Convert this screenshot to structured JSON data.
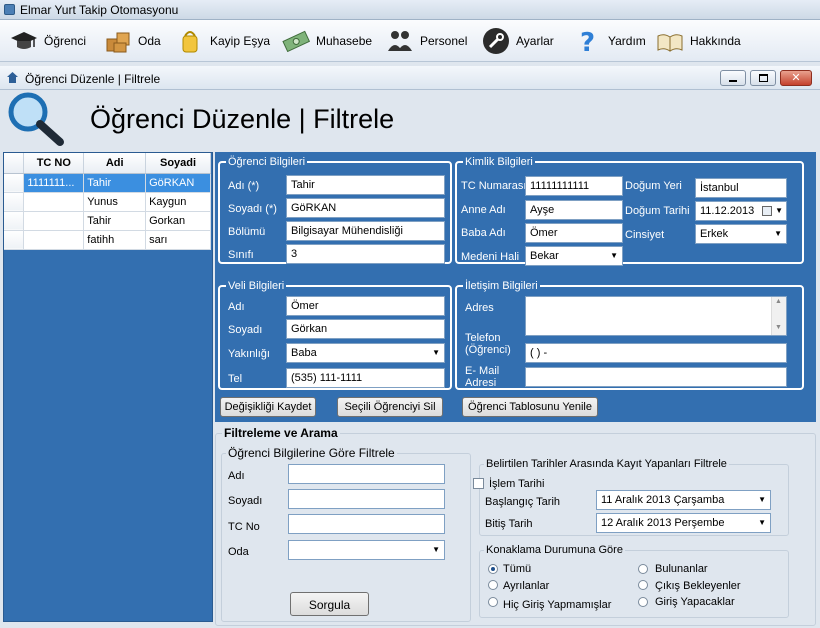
{
  "app": {
    "title": "Elmar Yurt Takip Otomasyonu"
  },
  "menu": [
    {
      "label": "Öğrenci",
      "icon": "graduation-cap-icon"
    },
    {
      "label": "Oda",
      "icon": "boxes-icon"
    },
    {
      "label": "Kayip Eşya",
      "icon": "bag-icon"
    },
    {
      "label": "Muhasebe",
      "icon": "money-icon"
    },
    {
      "label": "Personel",
      "icon": "people-icon"
    },
    {
      "label": "Ayarlar",
      "icon": "wrench-icon"
    },
    {
      "label": "Yardım",
      "icon": "question-icon"
    },
    {
      "label": "Hakkında",
      "icon": "book-icon"
    }
  ],
  "child_window": {
    "title": "Öğrenci Düzenle | Filtrele",
    "heading": "Öğrenci Düzenle | Filtrele"
  },
  "grid": {
    "columns": [
      "TC NO",
      "Adi",
      "Soyadi"
    ],
    "rows": [
      [
        "1111111...",
        "Tahir",
        "GöRKAN"
      ],
      [
        "",
        "Yunus",
        "Kaygun"
      ],
      [
        "",
        "Tahir",
        "Gorkan"
      ],
      [
        "",
        "fatihh",
        "sarı"
      ]
    ]
  },
  "student_info": {
    "legend": "Öğrenci Bilgileri",
    "ad_label": "Adı (*)",
    "ad_value": "Tahir",
    "soyad_label": "Soyadı (*)",
    "soyad_value": "GöRKAN",
    "bolum_label": "Bölümü",
    "bolum_value": "Bilgisayar Mühendisliği",
    "sinif_label": "Sınıfı",
    "sinif_value": "3"
  },
  "identity": {
    "legend": "Kimlik Bilgileri",
    "tc_label": "TC Numarası",
    "tc_value": "11111111111",
    "anne_label": "Anne Adı",
    "anne_value": "Ayşe",
    "baba_label": "Baba Adı",
    "baba_value": "Ömer",
    "medeni_label": "Medeni Hali",
    "medeni_value": "Bekar",
    "dyeri_label": "Doğum Yeri",
    "dyeri_value": "İstanbul",
    "dtarih_label": "Doğum Tarihi",
    "dtarih_value": "11.12.2013",
    "cinsiyet_label": "Cinsiyet",
    "cinsiyet_value": "Erkek"
  },
  "guardian": {
    "legend": "Veli Bilgileri",
    "ad_label": "Adı",
    "ad_value": "Ömer",
    "soyad_label": "Soyadı",
    "soyad_value": "Görkan",
    "yakinlik_label": "Yakınlığı",
    "yakinlik_value": "Baba",
    "tel_label": "Tel",
    "tel_value": "(535) 111-1111"
  },
  "contact": {
    "legend": "İletişim Bilgileri",
    "adres_label": "Adres",
    "adres_value": "",
    "telefon_label": "Telefon (Öğrenci)",
    "telefon_value": "(   )   -",
    "email_label": "E- Mail Adresi",
    "email_value": ""
  },
  "buttons": {
    "save": "Değişikliği Kaydet",
    "delete": "Seçili Öğrenciyi Sil",
    "refresh": "Öğrenci Tablosunu Yenile",
    "query": "Sorgula"
  },
  "filter": {
    "title": "Filtreleme ve Arama",
    "student_legend": "Öğrenci Bilgilerine Göre Filtrele",
    "ad_label": "Adı",
    "soyad_label": "Soyadı",
    "tc_label": "TC No",
    "oda_label": "Oda",
    "date_legend": "Belirtilen Tarihler Arasında Kayıt Yapanları Filtrele",
    "islem_label": "İşlem Tarihi",
    "start_label": "Başlangıç Tarih",
    "start_value": "11    Aralık    2013 Çarşamba",
    "end_label": "Bitiş Tarih",
    "end_value": "12    Aralık    2013 Perşembe",
    "stay_legend": "Konaklama Durumuna Göre",
    "radios": [
      "Tümü",
      "Ayrılanlar",
      "Hiç Giriş Yapmamışlar",
      "Bulunanlar",
      "Çıkış Bekleyenler",
      "Giriş Yapacaklar"
    ],
    "selected_radio": "Tümü"
  },
  "colors": {
    "panel": "#336fb0",
    "selected_row": "#3b8fe0",
    "background": "#dfe6ee"
  }
}
